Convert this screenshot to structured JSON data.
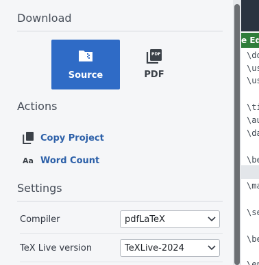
{
  "download": {
    "title": "Download",
    "source_label": "Source",
    "pdf_label": "PDF",
    "pdf_icon_text": "PDF"
  },
  "actions": {
    "title": "Actions",
    "copy_project": "Copy Project",
    "word_count": "Word Count",
    "word_count_icon_text": "Aa"
  },
  "settings": {
    "title": "Settings",
    "compiler_label": "Compiler",
    "compiler_value": "pdfLaTeX",
    "texlive_label": "TeX Live version",
    "texlive_value": "TeXLive-2024"
  },
  "editor": {
    "tab_label": "e Ed",
    "lines": [
      "\\do",
      "\\us",
      "\\us",
      "\\ti",
      "\\au",
      "\\da",
      "\\be",
      "\\ma",
      "\\se",
      "\\be",
      "\\en"
    ]
  },
  "colors": {
    "accent": "#2f6bc6",
    "link": "#2b5fa8",
    "panel_bg": "#f5f6f8",
    "editor_tab": "#2f7d3a"
  }
}
